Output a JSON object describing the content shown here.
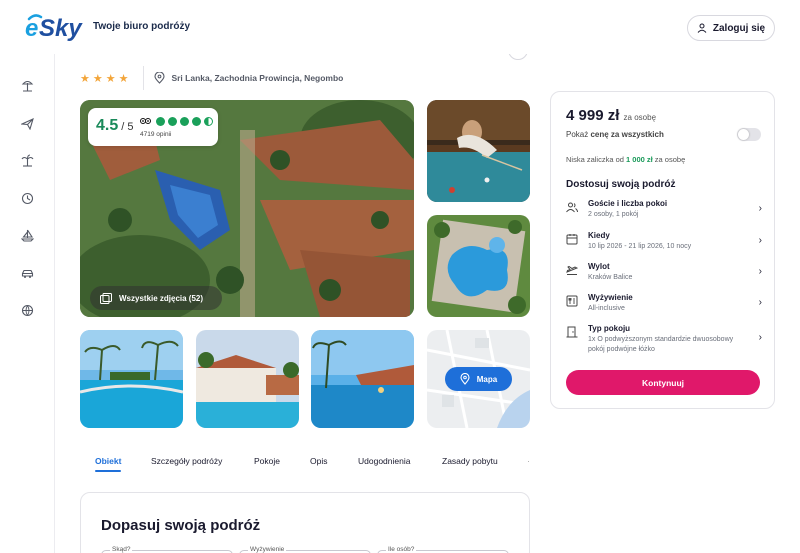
{
  "header": {
    "logo": "eSky",
    "tagline": "Twoje biuro podróży",
    "login_label": "Zaloguj się"
  },
  "sidenav": {
    "icons": [
      "beach-icon",
      "plane-icon",
      "palm-icon",
      "clock-icon",
      "sailboat-icon",
      "car-icon",
      "globe-icon"
    ]
  },
  "hotel": {
    "stars": "★★★★",
    "location": "Sri Lanka, Zachodnia Prowincja, Negombo"
  },
  "rating": {
    "score": "4.5",
    "of": " / 5",
    "reviews": "4719 opinii",
    "tripadvisor_bubbles": 4.5
  },
  "gallery": {
    "all_photos_label": "Wszystkie zdjęcia (52)",
    "map_label": "Mapa"
  },
  "booking": {
    "price": "4 999 zł",
    "per_person": "za osobę",
    "total_prefix": "Pokaż ",
    "total_bold": "cenę za wszystkich",
    "deposit_prefix": "Niska zaliczka od ",
    "deposit_amount": "1 000 zł",
    "deposit_suffix": " za osobę",
    "customize_title": "Dostosuj swoją podróż",
    "options": [
      {
        "title": "Goście i liczba pokoi",
        "value": "2 osoby, 1 pokój",
        "icon": "guests-icon"
      },
      {
        "title": "Kiedy",
        "value": "10 lip 2026 - 21 lip 2026, 10 nocy",
        "icon": "calendar-icon"
      },
      {
        "title": "Wylot",
        "value": "Kraków Balice",
        "icon": "departure-icon"
      },
      {
        "title": "Wyżywienie",
        "value": "All-inclusive",
        "icon": "meal-icon"
      },
      {
        "title": "Typ pokoju",
        "value": "1x O podwyższonym standardzie dwuosobowy pokój podwójne łóżko",
        "icon": "door-icon"
      }
    ],
    "cta_label": "Kontynuuj"
  },
  "tabs": [
    "Obiekt",
    "Szczegóły podróży",
    "Pokoje",
    "Opis",
    "Udogodnienia",
    "Zasady pobytu"
  ],
  "lower": {
    "title": "Dopasuj swoją podróż",
    "fields": [
      "Skąd?",
      "Wyżywienie",
      "Ile osób?"
    ]
  },
  "colors": {
    "brand_blue": "#1f4fa0",
    "accent_blue": "#1e6fd9",
    "cta_pink": "#e0186a",
    "rating_green": "#1a8a5a",
    "star_orange": "#f3a53a"
  }
}
